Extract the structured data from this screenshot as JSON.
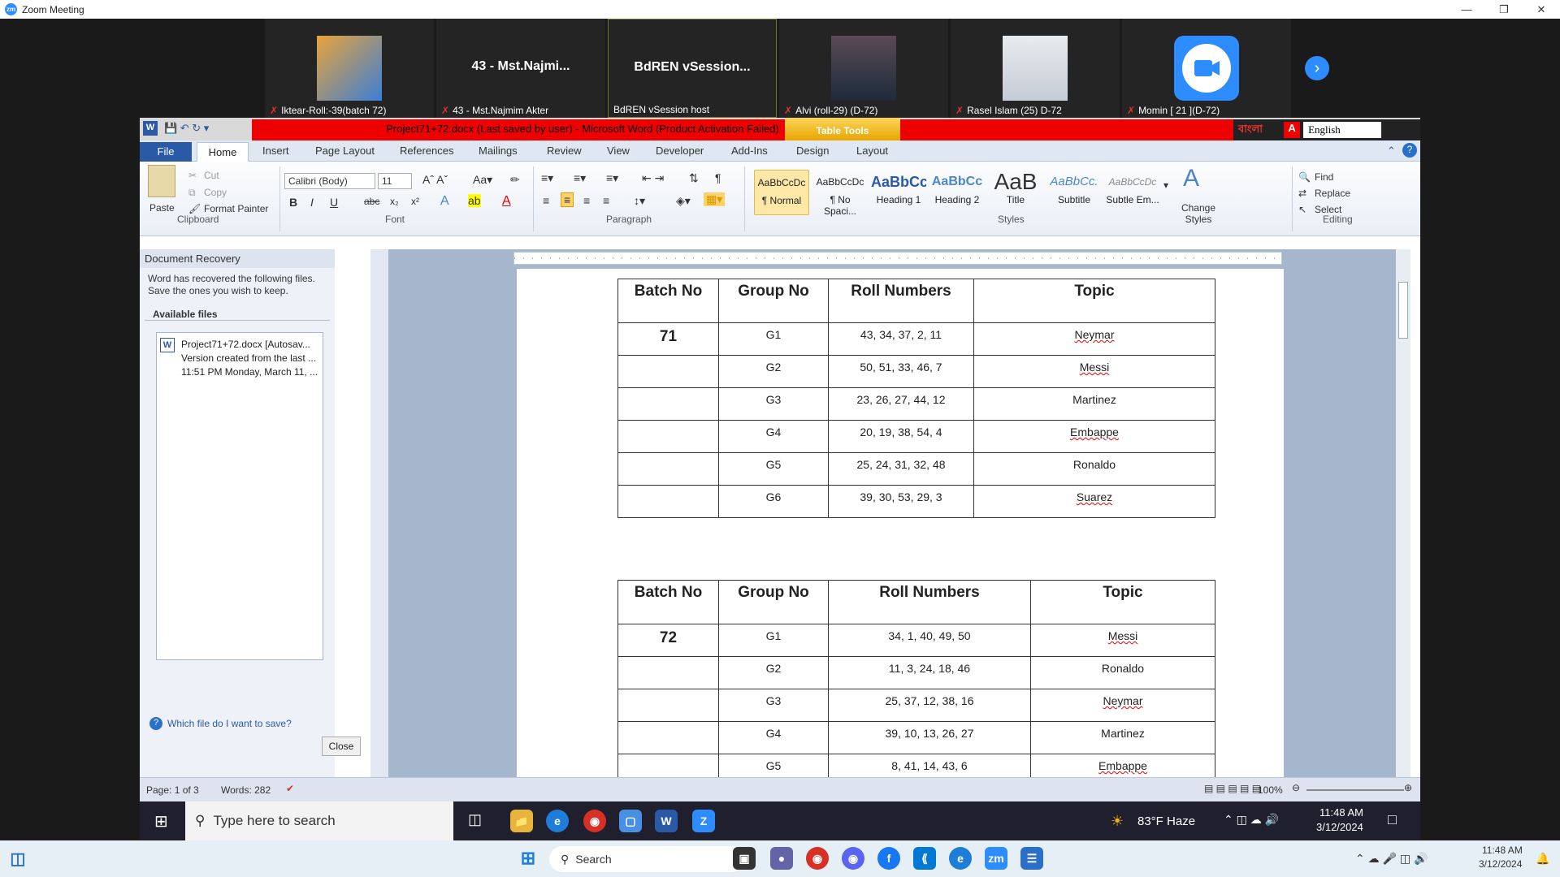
{
  "zoom": {
    "title": "Zoom Meeting",
    "logo": "zm"
  },
  "participants": [
    {
      "name": "Iktear-Roll:-39(batch 72)",
      "big": ""
    },
    {
      "name": "43 - Mst.Najmim Akter",
      "big": "43 - Mst.Najmi..."
    },
    {
      "name": "BdREN vSession host",
      "big": "BdREN vSession..."
    },
    {
      "name": "Alvi (roll-29) (D-72)",
      "big": ""
    },
    {
      "name": "Rasel Islam (25)  D-72",
      "big": ""
    },
    {
      "name": "Momin [ 21 ](D-72)",
      "big": ""
    }
  ],
  "word": {
    "title": "Project71+72.docx (Last saved by user)  -  Microsoft Word (Product Activation Failed)",
    "table_tools": "Table Tools",
    "lang": "English",
    "bangla": "বাংলা",
    "tabs": [
      "File",
      "Home",
      "Insert",
      "Page Layout",
      "References",
      "Mailings",
      "Review",
      "View",
      "Developer",
      "Add-Ins",
      "Design",
      "Layout"
    ],
    "clipboard": {
      "paste": "Paste",
      "cut": "Cut",
      "copy": "Copy",
      "format_painter": "Format Painter",
      "group": "Clipboard"
    },
    "font": {
      "name": "Calibri (Body)",
      "size": "11",
      "group": "Font"
    },
    "paragraph_group": "Paragraph",
    "styles": [
      {
        "preview": "AaBbCcDc",
        "label": "¶ Normal"
      },
      {
        "preview": "AaBbCcDc",
        "label": "¶ No Spaci..."
      },
      {
        "preview": "AaBbCc",
        "label": "Heading 1"
      },
      {
        "preview": "AaBbCc",
        "label": "Heading 2"
      },
      {
        "preview": "AaB",
        "label": "Title"
      },
      {
        "preview": "AaBbCc.",
        "label": "Subtitle"
      },
      {
        "preview": "AaBbCcDc",
        "label": "Subtle Em..."
      }
    ],
    "styles_group": "Styles",
    "change_styles": "Change Styles",
    "editing": {
      "find": "Find",
      "replace": "Replace",
      "select": "Select",
      "group": "Editing"
    },
    "recovery": {
      "title": "Document Recovery",
      "desc": "Word has recovered the following files.  Save the ones you wish to keep.",
      "available": "Available files",
      "file1": "Project71+72.docx  [Autosav...",
      "file2": "Version created from the last ...",
      "file3": "11:51 PM Monday, March 11, ...",
      "help": "Which file do I want to save?",
      "close": "Close"
    },
    "status": {
      "page": "Page: 1 of 3",
      "words": "Words: 282",
      "zoom": "100%"
    }
  },
  "table71": {
    "headers": [
      "Batch No",
      "Group No",
      "Roll Numbers",
      "Topic"
    ],
    "batch": "71",
    "rows": [
      [
        "G1",
        "43, 34, 37, 2, 11",
        "Neymar"
      ],
      [
        "G2",
        "50, 51, 33, 46, 7",
        "Messi"
      ],
      [
        "G3",
        "23, 26, 27, 44, 12",
        "Martinez"
      ],
      [
        "G4",
        "20, 19, 38, 54, 4",
        "Embappe"
      ],
      [
        "G5",
        "25, 24, 31, 32, 48",
        "Ronaldo"
      ],
      [
        "G6",
        "39, 30, 53, 29, 3",
        "Suarez"
      ]
    ]
  },
  "table72": {
    "headers": [
      "Batch No",
      "Group No",
      "Roll Numbers",
      "Topic"
    ],
    "batch": "72",
    "rows": [
      [
        "G1",
        "34, 1, 40, 49, 50",
        "Messi"
      ],
      [
        "G2",
        "11, 3, 24, 18, 46",
        "Ronaldo"
      ],
      [
        "G3",
        "25, 37, 12, 38, 16",
        "Neymar"
      ],
      [
        "G4",
        "39, 10, 13, 26, 27",
        "Martinez"
      ],
      [
        "G5",
        "8, 41, 14, 43, 6",
        "Embappe"
      ]
    ]
  },
  "taskbar1": {
    "search": "Type here to search",
    "weather": "83°F  Haze",
    "time": "11:48 AM",
    "date": "3/12/2024"
  },
  "taskbar2": {
    "search": "Search",
    "time": "11:48 AM",
    "date": "3/12/2024"
  }
}
